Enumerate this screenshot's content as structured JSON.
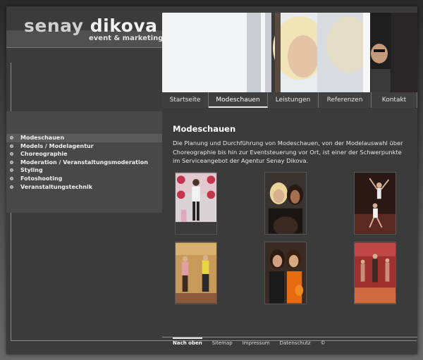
{
  "logo": {
    "name_light": "senay",
    "name_bold": "dikova",
    "tagline": "event & marketing"
  },
  "nav": {
    "tabs": [
      {
        "label": "Startseite",
        "active": false
      },
      {
        "label": "Modeschauen",
        "active": true
      },
      {
        "label": "Leistungen",
        "active": false
      },
      {
        "label": "Referenzen",
        "active": false
      },
      {
        "label": "Kontakt",
        "active": false
      }
    ]
  },
  "sidebar": {
    "items": [
      {
        "label": "Modeschauen",
        "active": true
      },
      {
        "label": "Models / Modelagentur",
        "active": false
      },
      {
        "label": "Choreographie",
        "active": false
      },
      {
        "label": "Moderation / Veranstaltungsmoderation",
        "active": false
      },
      {
        "label": "Styling",
        "active": false
      },
      {
        "label": "Fotoshooting",
        "active": false
      },
      {
        "label": "Veranstaltungstechnik",
        "active": false
      }
    ]
  },
  "content": {
    "title": "Modeschauen",
    "text": "Die Planung und Durchführung von Modeschauen, von der Modelauswahl über Choreographie bis hin zur Eventsteuerung vor Ort, ist einer der Schwerpunkte im Serviceangebot der Agentur Senay Dikova."
  },
  "gallery": {
    "items": [
      {
        "icon": "fashion-show-photo-icon"
      },
      {
        "icon": "models-portrait-photo-icon"
      },
      {
        "icon": "dance-performance-photo-icon"
      },
      {
        "icon": "runway-photo-icon"
      },
      {
        "icon": "models-smiling-photo-icon"
      },
      {
        "icon": "stage-show-photo-icon"
      }
    ]
  },
  "footer": {
    "links": [
      "Nach oben",
      "Sitemap",
      "Impressum",
      "Datenschutz",
      "©"
    ]
  },
  "colors": {
    "background": "#3b3b3b",
    "sidebar_panel": "#484848",
    "text": "#f0f0f0"
  }
}
